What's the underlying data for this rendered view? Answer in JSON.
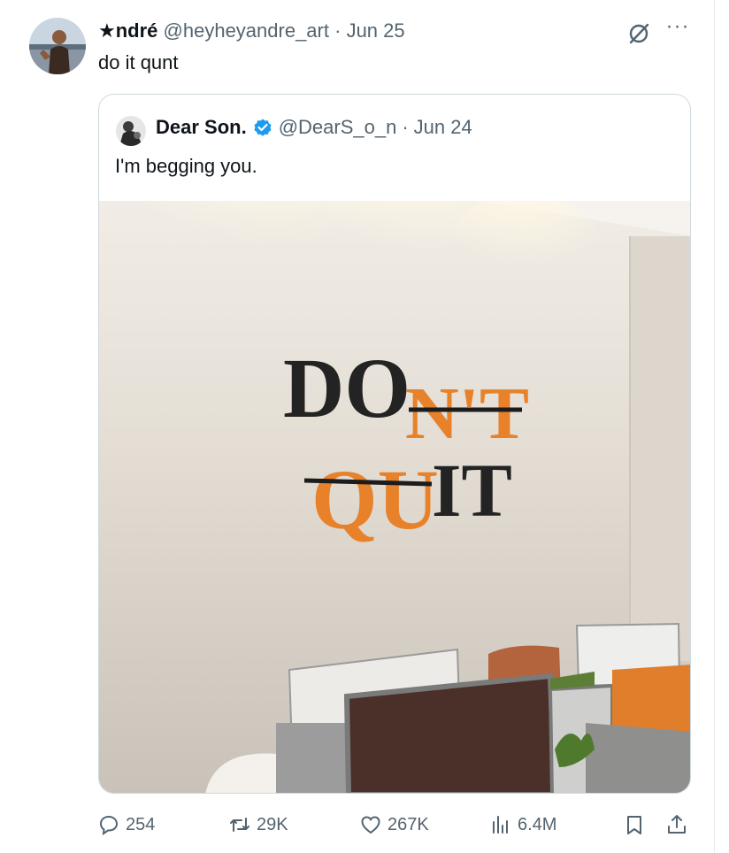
{
  "tweet": {
    "author_name": "★ndré",
    "handle": "@heyheyandre_art",
    "separator": "·",
    "date": "Jun 25",
    "text": "do it qunt",
    "more_label": "···"
  },
  "quote": {
    "author_name": "Dear Son.",
    "handle": "@DearS_o_n",
    "separator": "·",
    "date": "Jun 24",
    "text": "I'm begging you.",
    "sign_words": [
      "DON'T",
      "QUIT"
    ]
  },
  "actions": {
    "replies": "254",
    "reposts": "29K",
    "likes": "267K",
    "views": "6.4M"
  },
  "colors": {
    "accent_orange": "#e8822a",
    "verified_blue": "#1d9bf0",
    "muted_text": "#536471"
  }
}
